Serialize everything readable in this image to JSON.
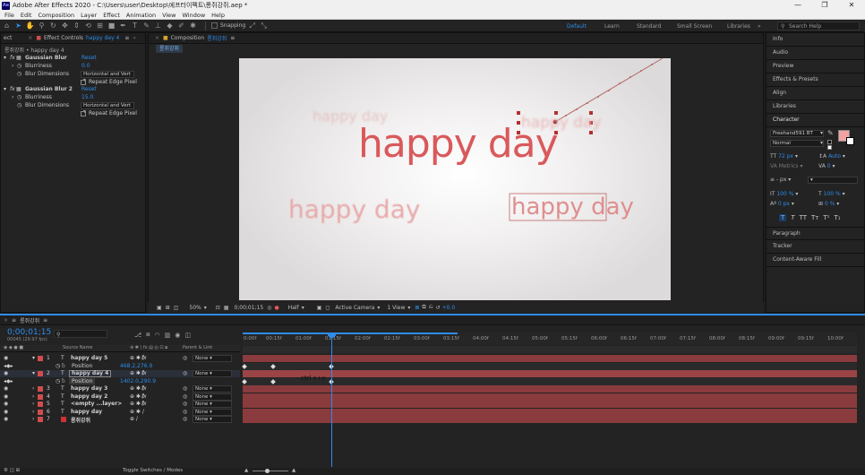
{
  "window": {
    "title": "Adobe After Effects 2020 - C:\\Users\\user\\Desktop\\에프터이펙트\\롱쥐강쥐.aep *",
    "logo": "Ae",
    "min": "—",
    "max": "❐",
    "close": "✕"
  },
  "menu": [
    "File",
    "Edit",
    "Composition",
    "Layer",
    "Effect",
    "Animation",
    "View",
    "Window",
    "Help"
  ],
  "toolbar": {
    "snapping": "Snapping",
    "workspaces": [
      "Default",
      "Learn",
      "Standard",
      "Small Screen",
      "Libraries"
    ],
    "active_workspace": "Default",
    "search_placeholder": "Search Help"
  },
  "effect_controls": {
    "left_tab": "ect",
    "tab": "Effect Controls",
    "tab_layer": "happy day 4",
    "breadcrumb": "롱쥐강쥐 • happy day 4",
    "effects": [
      {
        "name": "Gaussian Blur",
        "reset": "Reset",
        "blurriness_label": "Blurriness",
        "blurriness": "0.0",
        "dims_label": "Blur Dimensions",
        "dims": "Horizontal and Vert",
        "repeat": "Repeat Edge Pixel"
      },
      {
        "name": "Gaussian Blur 2",
        "reset": "Reset",
        "blurriness_label": "Blurriness",
        "blurriness": "15.0",
        "dims_label": "Blur Dimensions",
        "dims": "Horizontal and Vert",
        "repeat": "Repeat Edge Pixel"
      }
    ]
  },
  "composition": {
    "tab_label": "Composition",
    "tab_name": "롱쥐강쥐",
    "subtab": "롱쥐강쥐",
    "text": "happy day",
    "bottom": {
      "zoom": "50%",
      "time": "0;00;01;15",
      "resolution": "Half",
      "camera": "Active Camera",
      "view": "1 View",
      "exposure": "+0.0"
    }
  },
  "right_panel": {
    "tabs": [
      "Info",
      "Audio",
      "Preview",
      "Effects & Presets",
      "Align",
      "Libraries"
    ],
    "character": {
      "title": "Character",
      "font": "Freehand591 BT",
      "style": "Normal",
      "size": "72 px",
      "leading": "Auto",
      "kerning": "Metrics",
      "tracking": "0",
      "stroke": "- px",
      "vscale": "100 %",
      "hscale": "100 %",
      "baseline": "0 px",
      "tsume": "0 %",
      "styles": [
        "T",
        "T",
        "TT",
        "Tт",
        "T¹",
        "T₁"
      ]
    },
    "bottom_tabs": [
      "Paragraph",
      "Tracker",
      "Content-Aware Fill"
    ]
  },
  "timeline": {
    "comp_tab": "롱쥐강쥐",
    "timecode": "0;00;01;15",
    "frames": "00045 (29.97 fps)",
    "col_source": "Source Name",
    "col_parent": "Parent & Link",
    "ticks": [
      "0:00f",
      "00:15f",
      "01:00f",
      "01:15f",
      "02:00f",
      "02:15f",
      "03:00f",
      "03:15f",
      "04:00f",
      "04:15f",
      "05:00f",
      "05:15f",
      "06:00f",
      "06:15f",
      "07:00f",
      "07:15f",
      "08:00f",
      "08:15f",
      "09:00f",
      "09:15f",
      "10:00f"
    ],
    "layers": [
      {
        "num": "1",
        "name": "happy day 5",
        "parent": "None"
      },
      {
        "prop": "Position",
        "value": "468.2,276.9"
      },
      {
        "num": "2",
        "name": "happy day 4",
        "parent": "None"
      },
      {
        "prop": "Position",
        "value": "1402.0,290.9"
      },
      {
        "num": "3",
        "name": "happy day 3",
        "parent": "None"
      },
      {
        "num": "4",
        "name": "happy day 2",
        "parent": "None"
      },
      {
        "num": "5",
        "name": "<empty ...layer>",
        "parent": "None"
      },
      {
        "num": "6",
        "name": "happy day",
        "parent": "None"
      },
      {
        "num": "7",
        "name": "롱쥐강쥐",
        "parent": "None"
      }
    ],
    "annotation": "ctrl c+v",
    "toggle": "Toggle Switches / Modes"
  },
  "colors": {
    "accent": "#2d8ceb",
    "text_red": "#d9595b",
    "bar_red": "#8a3b3d"
  }
}
